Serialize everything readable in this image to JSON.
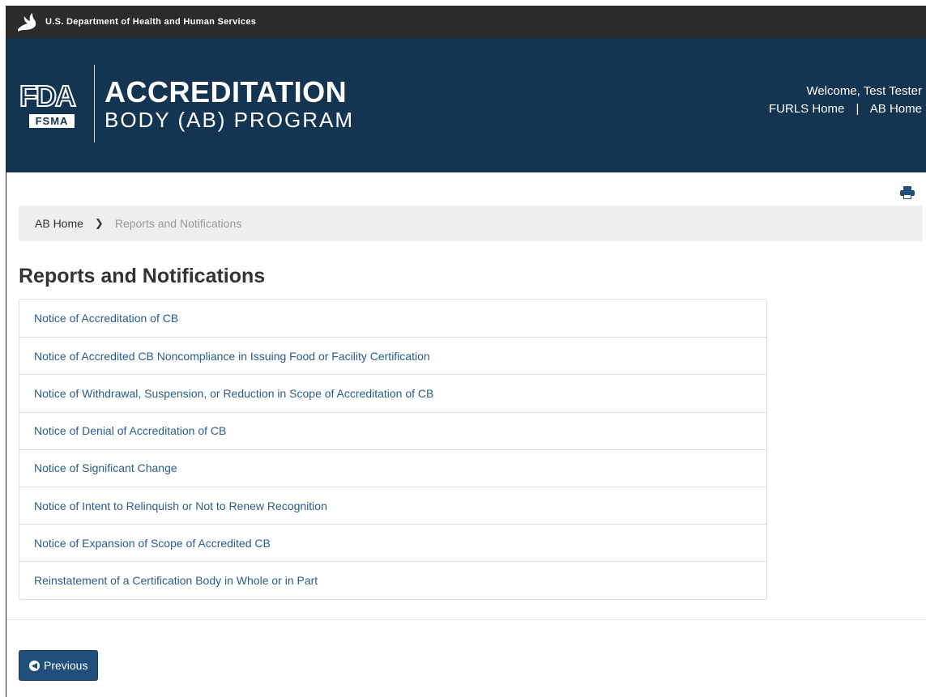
{
  "hhs_bar": {
    "text": "U.S. Department of Health and Human Services"
  },
  "logo": {
    "fda": "FDA",
    "fsma": "FSMA"
  },
  "program": {
    "title_line1": "ACCREDITATION",
    "title_line2": "BODY (AB) PROGRAM"
  },
  "user": {
    "welcome": "Welcome, Test Tester",
    "furls_home": "FURLS Home",
    "separator": "|",
    "ab_home": "AB Home"
  },
  "breadcrumb": {
    "home": "AB Home",
    "current": "Reports and Notifications"
  },
  "page": {
    "title": "Reports and Notifications"
  },
  "links": [
    "Notice of Accreditation of CB",
    "Notice of Accredited CB Noncompliance in Issuing Food or Facility Certification",
    "Notice of Withdrawal, Suspension, or Reduction in Scope of Accreditation of CB",
    "Notice of Denial of Accreditation of CB",
    "Notice of Significant Change",
    "Notice of Intent to Relinquish or Not to Renew Recognition",
    "Notice of Expansion of Scope of Accredited CB",
    "Reinstatement of a Certification Body in Whole or in Part"
  ],
  "buttons": {
    "previous": "Previous"
  },
  "icons": {
    "eagle": "hhs-eagle-icon",
    "print": "print-icon",
    "chevron": "chevron-right-icon",
    "previous": "circle-arrow-left-icon"
  },
  "colors": {
    "top_bar": "#2b2b2b",
    "header": "#143552",
    "link": "#2a5d8a",
    "button": "#1f4f7a"
  }
}
